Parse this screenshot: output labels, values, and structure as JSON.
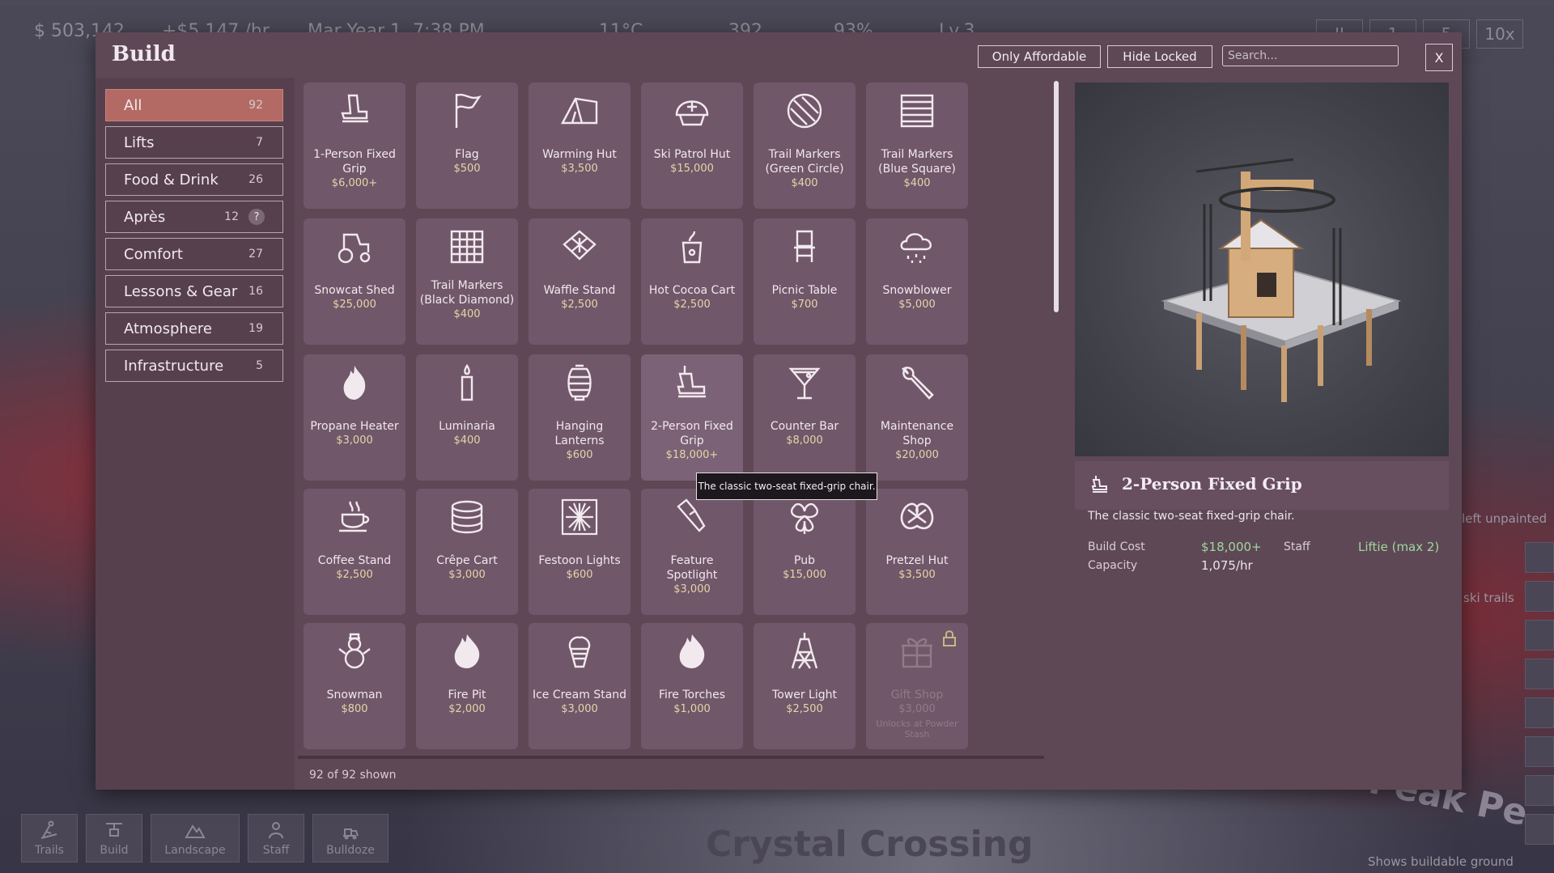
{
  "hud": {
    "money": "$ 503,142",
    "rate": "+$5,147 /hr",
    "date": "Mar Year 1, 7:38 PM",
    "temp": "11°C",
    "guests": "392",
    "rating": "93%",
    "level": "Lv.3",
    "speeds": [
      "II",
      "1",
      "5",
      "10x"
    ]
  },
  "panel": {
    "title": "Build",
    "only_affordable": "Only Affordable",
    "hide_locked": "Hide Locked",
    "search_placeholder": "Search...",
    "close": "X",
    "shown_text": "92 of 92 shown"
  },
  "categories": [
    {
      "label": "All",
      "count": "92",
      "active": true
    },
    {
      "label": "Lifts",
      "count": "7"
    },
    {
      "label": "Food & Drink",
      "count": "26"
    },
    {
      "label": "Après",
      "count": "12",
      "help": "?"
    },
    {
      "label": "Comfort",
      "count": "27"
    },
    {
      "label": "Lessons & Gear",
      "count": "16"
    },
    {
      "label": "Atmosphere",
      "count": "19"
    },
    {
      "label": "Infrastructure",
      "count": "5"
    }
  ],
  "items": [
    {
      "name": "1-Person Fixed Grip",
      "price": "$6,000+",
      "icon": "chairlift-seat-icon"
    },
    {
      "name": "Flag",
      "price": "$500",
      "icon": "flag-icon"
    },
    {
      "name": "Warming Hut",
      "price": "$3,500",
      "icon": "tent-icon"
    },
    {
      "name": "Ski Patrol Hut",
      "price": "$15,000",
      "icon": "helmet-cross-icon"
    },
    {
      "name": "Trail Markers (Green Circle)",
      "price": "$400",
      "icon": "green-circle-marker-icon"
    },
    {
      "name": "Trail Markers (Blue Square)",
      "price": "$400",
      "icon": "blue-square-marker-icon"
    },
    {
      "name": "Snowcat Shed",
      "price": "$25,000",
      "icon": "tractor-icon"
    },
    {
      "name": "Trail Markers (Black Diamond)",
      "price": "$400",
      "icon": "black-diamond-marker-icon"
    },
    {
      "name": "Waffle Stand",
      "price": "$2,500",
      "icon": "waffle-icon"
    },
    {
      "name": "Hot Cocoa Cart",
      "price": "$2,500",
      "icon": "cocoa-cup-icon"
    },
    {
      "name": "Picnic Table",
      "price": "$700",
      "icon": "chair-icon"
    },
    {
      "name": "Snowblower",
      "price": "$5,000",
      "icon": "snow-cloud-icon"
    },
    {
      "name": "Propane Heater",
      "price": "$3,000",
      "icon": "flame-icon"
    },
    {
      "name": "Luminaria",
      "price": "$400",
      "icon": "candle-icon"
    },
    {
      "name": "Hanging Lanterns",
      "price": "$600",
      "icon": "lantern-icon"
    },
    {
      "name": "2-Person Fixed Grip",
      "price": "$18,000+",
      "icon": "chairlift-double-icon"
    },
    {
      "name": "Counter Bar",
      "price": "$8,000",
      "icon": "cocktail-icon"
    },
    {
      "name": "Maintenance Shop",
      "price": "$20,000",
      "icon": "wrench-icon"
    },
    {
      "name": "Coffee Stand",
      "price": "$2,500",
      "icon": "coffee-cup-icon"
    },
    {
      "name": "Crêpe Cart",
      "price": "$3,000",
      "icon": "crepe-stack-icon"
    },
    {
      "name": "Festoon Lights",
      "price": "$600",
      "icon": "sparkle-lights-icon"
    },
    {
      "name": "Feature Spotlight",
      "price": "$3,000",
      "icon": "flashlight-icon"
    },
    {
      "name": "Pub",
      "price": "$15,000",
      "icon": "clover-icon"
    },
    {
      "name": "Pretzel Hut",
      "price": "$3,500",
      "icon": "pretzel-icon"
    },
    {
      "name": "Snowman",
      "price": "$800",
      "icon": "snowman-icon"
    },
    {
      "name": "Fire Pit",
      "price": "$2,000",
      "icon": "fire-icon"
    },
    {
      "name": "Ice Cream Stand",
      "price": "$3,000",
      "icon": "ice-cream-icon"
    },
    {
      "name": "Fire Torches",
      "price": "$1,000",
      "icon": "torch-flame-icon"
    },
    {
      "name": "Tower Light",
      "price": "$2,500",
      "icon": "tower-icon"
    },
    {
      "name": "Gift Shop",
      "price": "$3,000",
      "icon": "gift-box-icon",
      "locked": true,
      "unlock": "Unlocks at Powder Stash"
    }
  ],
  "tooltip": "The classic two-seat fixed-grip chair.",
  "detail": {
    "title": "2-Person Fixed Grip",
    "description": "The classic two-seat fixed-grip chair.",
    "build_cost_label": "Build Cost",
    "build_cost": "$18,000+",
    "staff_label": "Staff",
    "staff": "Liftie (max 2)",
    "capacity_label": "Capacity",
    "capacity": "1,075/hr"
  },
  "bottom_toolbar": [
    {
      "label": "Trails",
      "icon": "skier-icon"
    },
    {
      "label": "Build",
      "icon": "chairlift-icon"
    },
    {
      "label": "Landscape",
      "icon": "mountain-icon"
    },
    {
      "label": "Staff",
      "icon": "person-icon"
    },
    {
      "label": "Bulldoze",
      "icon": "bulldoze-icon"
    }
  ],
  "world": {
    "resort_name": "Crystal Crossing",
    "hint_unpainted": "left unpainted",
    "hint_trails": "ski trails",
    "hint_ground": "Shows buildable ground",
    "peak_label": "Peak Pe"
  }
}
